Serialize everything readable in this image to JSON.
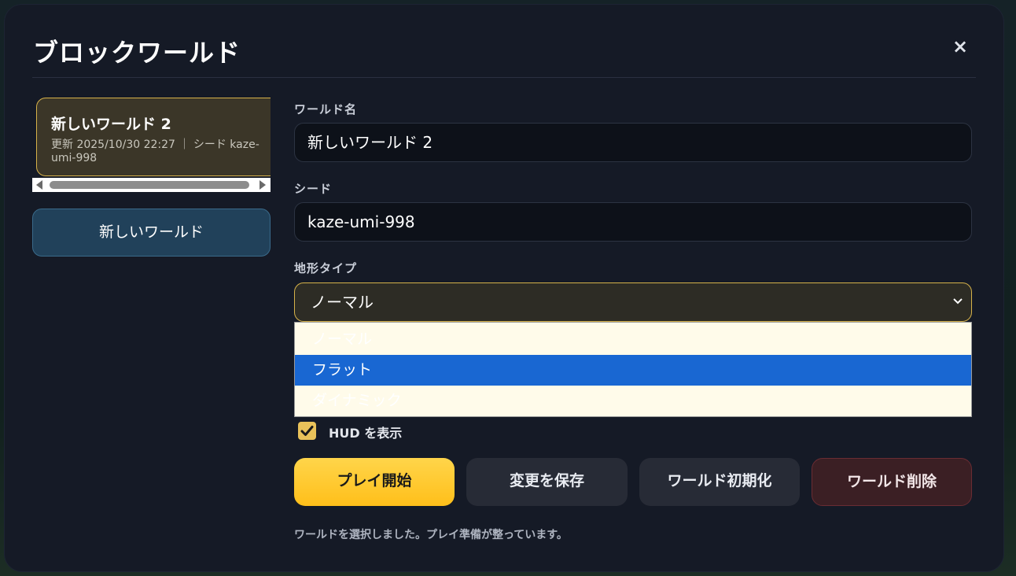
{
  "dialog": {
    "title": "ブロックワールド",
    "close_label": "×"
  },
  "world_list": {
    "items": [
      {
        "name": "新しいワールド 2",
        "meta": "更新 2025/10/30 22:27 ｜ シード kaze-umi-998"
      }
    ],
    "new_world_label": "新しいワールド"
  },
  "form": {
    "name_label": "ワールド名",
    "name_value": "新しいワールド 2",
    "seed_label": "シード",
    "seed_value": "kaze-umi-998",
    "terrain_label": "地形タイプ",
    "terrain_selected": "ノーマル",
    "terrain_options": [
      "ノーマル",
      "フラット",
      "ダイナミック"
    ],
    "hud_label": "HUD を表示",
    "hud_checked": true
  },
  "actions": {
    "play": "プレイ開始",
    "save": "変更を保存",
    "reset": "ワールド初期化",
    "delete": "ワールド削除"
  },
  "status_text": "ワールドを選択しました。プレイ準備が整っています。",
  "colors": {
    "accent": "#ffc72a",
    "highlight": "#1967d2",
    "danger": "#3b1f24"
  }
}
